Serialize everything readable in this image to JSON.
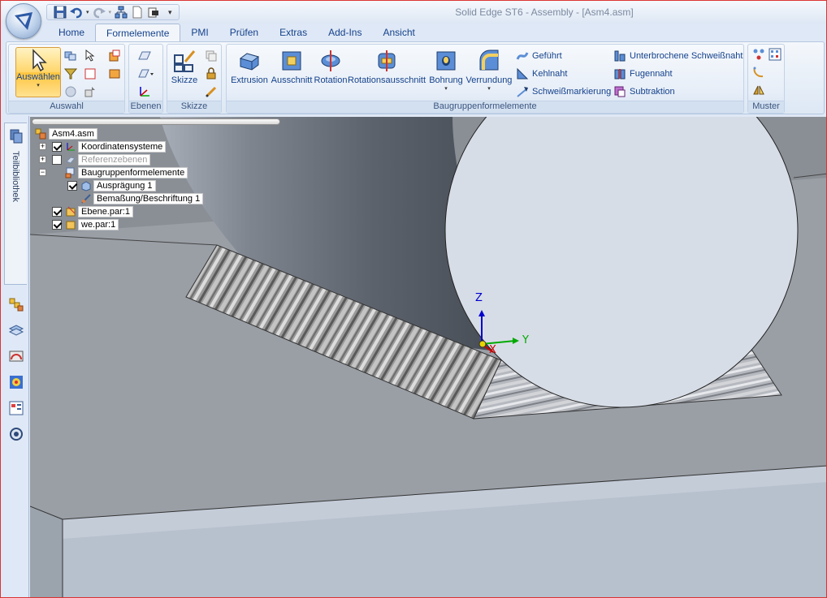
{
  "window": {
    "title": "Solid Edge ST6 - Assembly - [Asm4.asm]"
  },
  "quick_access": {
    "icons": [
      "save-icon",
      "undo-icon",
      "redo-icon",
      "structure-icon",
      "new-icon",
      "open-icon",
      "customize-icon"
    ]
  },
  "tabs": [
    "Home",
    "Formelemente",
    "PMI",
    "Prüfen",
    "Extras",
    "Add-Ins",
    "Ansicht"
  ],
  "active_tab": "Formelemente",
  "ribbon": {
    "auswahl": {
      "label": "Auswahl",
      "select_label": "Auswählen"
    },
    "ebenen": {
      "label": "Ebenen"
    },
    "skizze": {
      "label": "Skizze",
      "sketch_label": "Skizze"
    },
    "baugruppe": {
      "label": "Baugruppenformelemente",
      "buttons": [
        "Extrusion",
        "Ausschnitt",
        "Rotation",
        "Rotationsausschnitt",
        "Bohrung",
        "Verrundung"
      ],
      "small_col1": [
        "Geführt",
        "Kehlnaht",
        "Schweißmarkierung"
      ],
      "small_col2": [
        "Unterbrochene Schweißnaht",
        "Fugennaht",
        "Subtraktion"
      ]
    },
    "muster": {
      "label": "Muster"
    }
  },
  "sidebar": {
    "library_label": "Teilbibliothek"
  },
  "tree": {
    "root": "Asm4.asm",
    "nodes": [
      {
        "label": "Koordinatensysteme",
        "checked": true,
        "expander": "+"
      },
      {
        "label": "Referenzebenen",
        "checked": false,
        "expander": "+"
      },
      {
        "label": "Baugruppenformelemente",
        "expander": "−"
      },
      {
        "label": "Ausprägung 1",
        "checked": true
      },
      {
        "label": "Bemaßung/Beschriftung 1"
      },
      {
        "label": "Ebene.par:1",
        "checked": true
      },
      {
        "label": "we.par:1",
        "checked": true
      }
    ]
  },
  "triad": {
    "z": "Z",
    "y": "Y",
    "x": "X"
  },
  "colors": {
    "accent": "#ffc53d",
    "ribbon_text": "#15428b",
    "axis_z": "#0000cc",
    "axis_y": "#00aa00",
    "axis_x": "#cc0000"
  }
}
